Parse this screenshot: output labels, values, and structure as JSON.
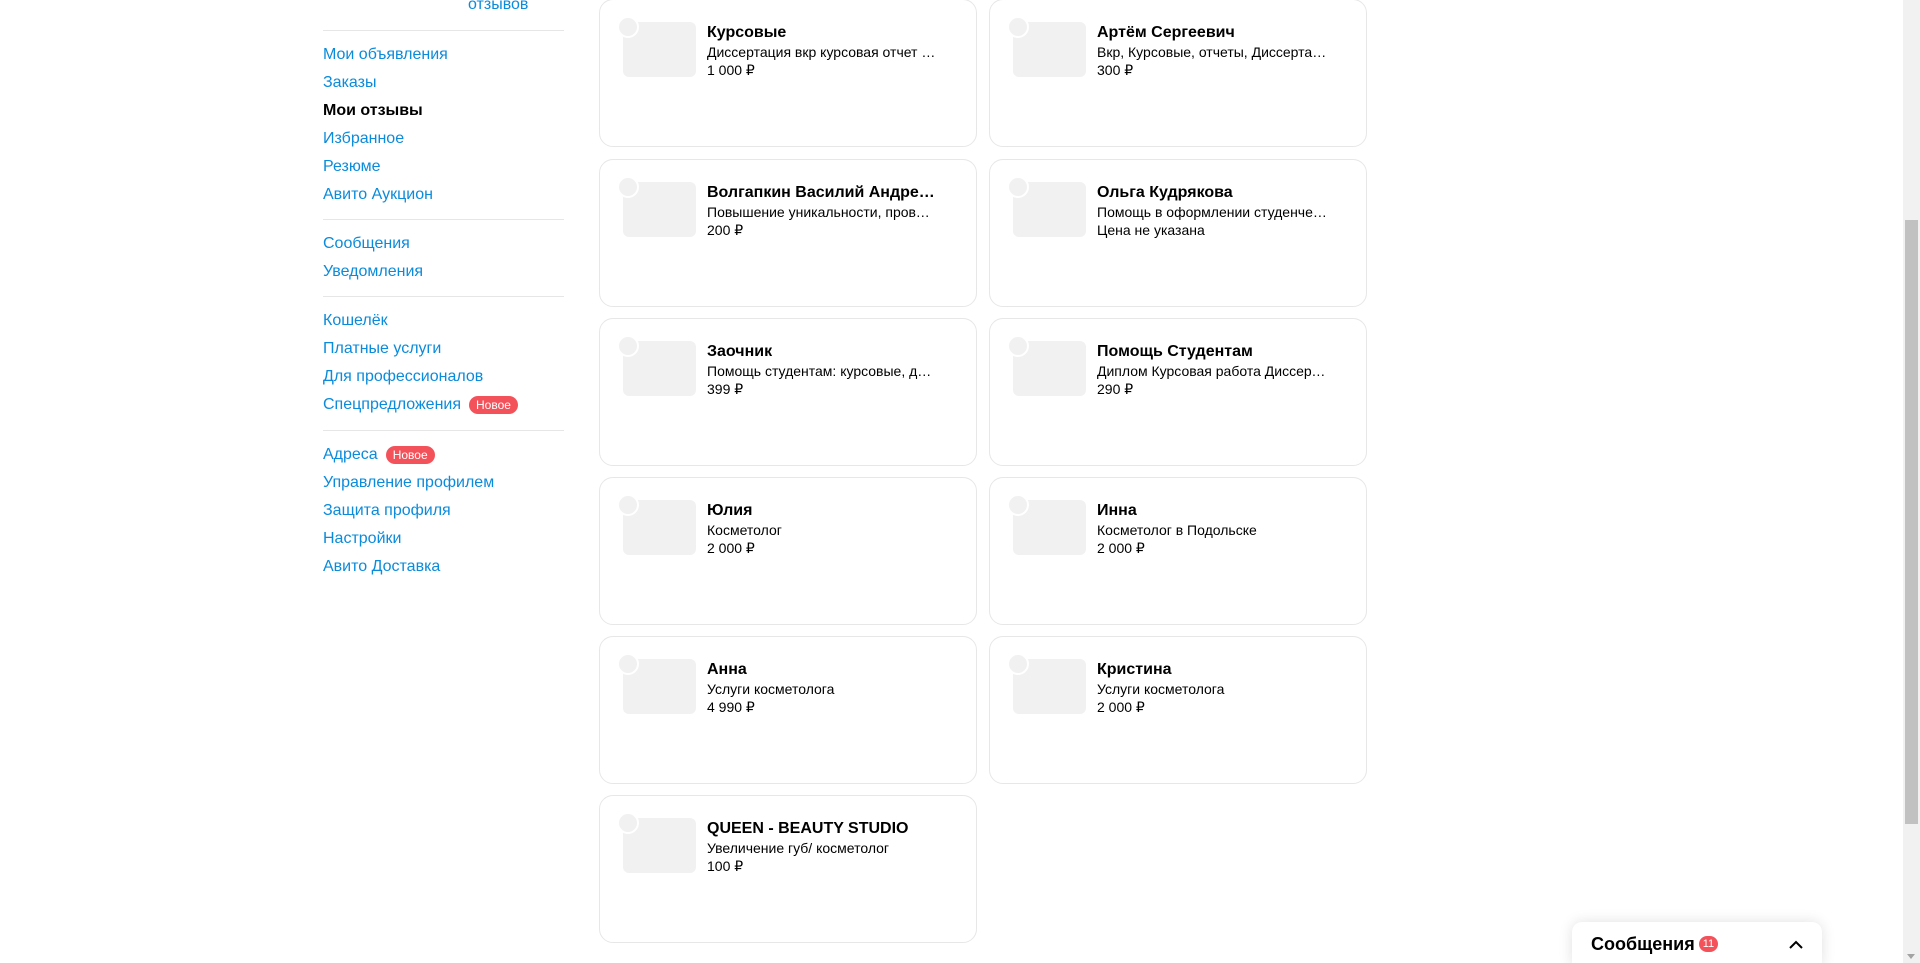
{
  "rating_link_text": "отзывов",
  "sidebar": {
    "group1": [
      {
        "label": "Мои объявления",
        "active": false
      },
      {
        "label": "Заказы",
        "active": false
      },
      {
        "label": "Мои отзывы",
        "active": true
      },
      {
        "label": "Избранное",
        "active": false
      },
      {
        "label": "Резюме",
        "active": false
      },
      {
        "label": "Авито Аукцион",
        "active": false
      }
    ],
    "group2": [
      {
        "label": "Сообщения"
      },
      {
        "label": "Уведомления"
      }
    ],
    "group3": [
      {
        "label": "Кошелёк"
      },
      {
        "label": "Платные услуги"
      },
      {
        "label": "Для профессионалов"
      },
      {
        "label": "Спецпредложения",
        "badge": "Новое"
      }
    ],
    "group4": [
      {
        "label": "Адреса",
        "badge": "Новое"
      },
      {
        "label": "Управление профилем"
      },
      {
        "label": "Защита профиля"
      },
      {
        "label": "Настройки"
      },
      {
        "label": "Авито Доставка"
      }
    ]
  },
  "cards": [
    {
      "name": "Курсовые",
      "desc": "Диссертация вкр курсовая отчет по практике",
      "price": "1 000 ₽"
    },
    {
      "name": "Артём Сергеевич",
      "desc": "Вкр, Курсовые, отчеты, Диссертации",
      "price": "300 ₽"
    },
    {
      "name": "Волгапкин Василий Андреевич",
      "desc": "Повышение уникальности, проверка",
      "price": "200 ₽"
    },
    {
      "name": "Ольга Кудрякова",
      "desc": "Помощь в оформлении студенческих работ",
      "price": "Цена не указана"
    },
    {
      "name": "Заочник",
      "desc": "Помощь студентам: курсовые, дипломы",
      "price": "399 ₽"
    },
    {
      "name": "Помощь Студентам",
      "desc": "Диплом Курсовая работа Диссертация",
      "price": "290 ₽"
    },
    {
      "name": "Юлия",
      "desc": "Косметолог",
      "price": "2 000 ₽"
    },
    {
      "name": "Инна",
      "desc": "Косметолог в Подольске",
      "price": "2 000 ₽"
    },
    {
      "name": "Анна",
      "desc": "Услуги косметолога",
      "price": "4 990 ₽"
    },
    {
      "name": "Кристина",
      "desc": "Услуги косметолога",
      "price": "2 000 ₽"
    },
    {
      "name": "QUEEN - BEAUTY STUDIO",
      "desc": "Увеличение губ/ косметолог",
      "price": "100 ₽"
    }
  ],
  "messages_widget": {
    "title": "Сообщения",
    "count": "11"
  },
  "colors": {
    "link": "#0a8bdb",
    "badge": "#f4525a",
    "card_border": "#e7e7e7",
    "thumb": "#f1f1f1"
  }
}
